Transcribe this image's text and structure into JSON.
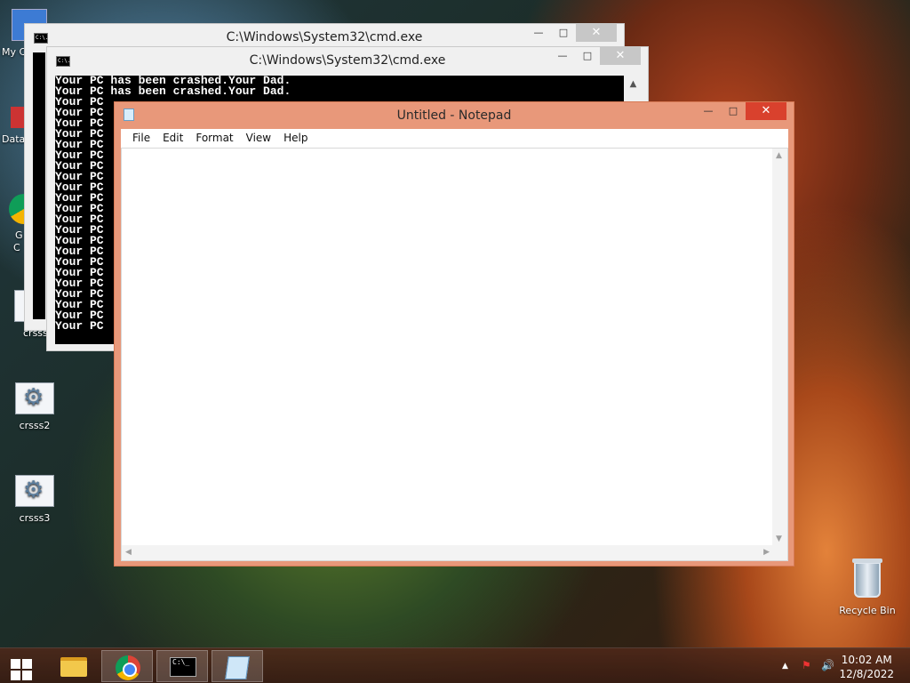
{
  "desktop": {
    "partial_icons": [
      {
        "label": "My C"
      },
      {
        "label": "Data"
      },
      {
        "label": "G"
      },
      {
        "label": "C"
      },
      {
        "label": "crsss"
      }
    ],
    "icons": [
      {
        "label": "crsss2"
      },
      {
        "label": "crsss3"
      }
    ],
    "recycle_bin": {
      "label": "Recycle Bin"
    }
  },
  "cmd_window_back": {
    "title": "C:\\Windows\\System32\\cmd.exe",
    "icon_text": "C:\\."
  },
  "cmd_window_front": {
    "title": "C:\\Windows\\System32\\cmd.exe",
    "icon_text": "C:\\.",
    "lines": [
      "Your PC has been crashed.Your Dad.",
      "Your PC has been crashed.Your Dad.",
      "Your PC",
      "Your PC",
      "Your PC",
      "Your PC",
      "Your PC",
      "Your PC",
      "Your PC",
      "Your PC",
      "Your PC",
      "Your PC",
      "Your PC",
      "Your PC",
      "Your PC",
      "Your PC",
      "Your PC",
      "Your PC",
      "Your PC",
      "Your PC",
      "Your PC",
      "Your PC",
      "Your PC",
      "Your PC"
    ]
  },
  "notepad": {
    "title": "Untitled - Notepad",
    "menu": [
      "File",
      "Edit",
      "Format",
      "View",
      "Help"
    ],
    "content": ""
  },
  "window_controls": {
    "minimize": "—",
    "maximize": "□",
    "close": "✕"
  },
  "taskbar": {
    "clock_time": "10:02 AM",
    "clock_date": "12/8/2022",
    "cmd_icon_text": "C:\\_"
  },
  "colors": {
    "notepad_frame": "#e8987a",
    "close_active": "#d9412d"
  }
}
